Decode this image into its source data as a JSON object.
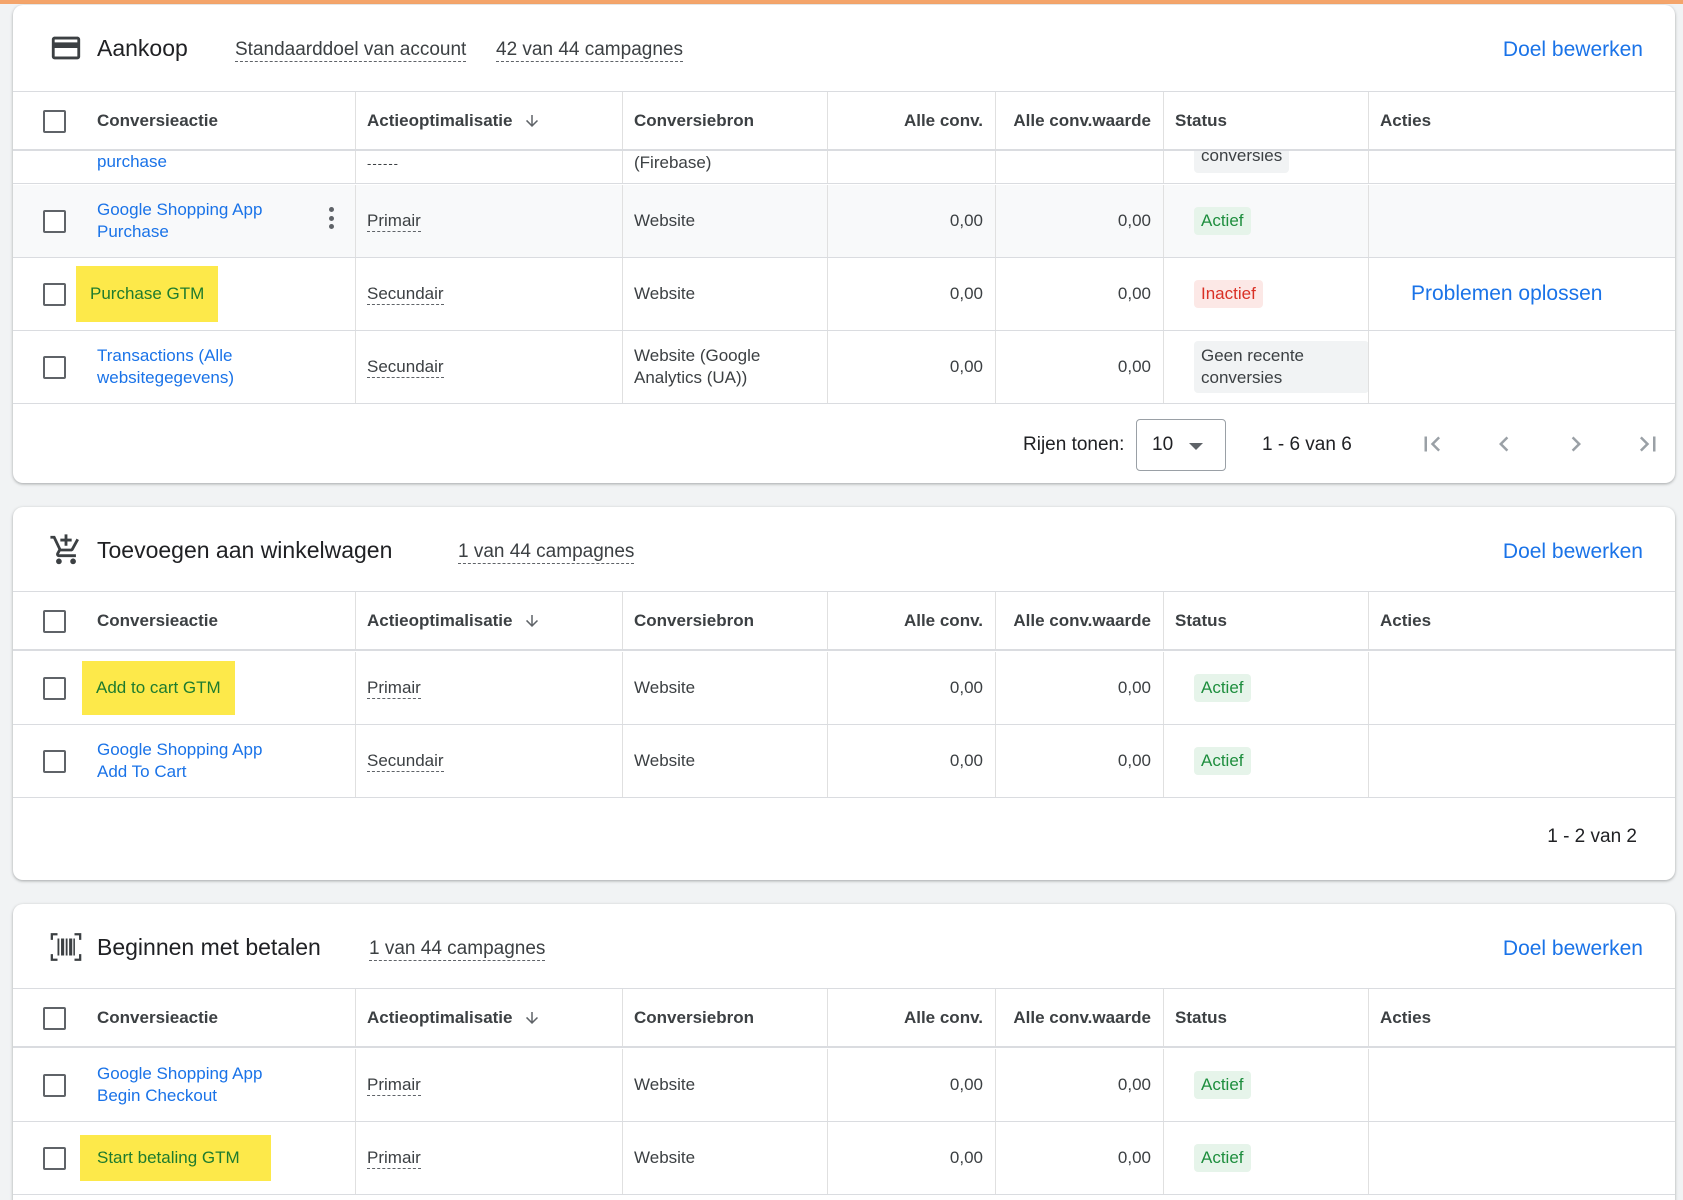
{
  "columns": {
    "name": "Conversieactie",
    "optimization": "Actieoptimalisatie",
    "source": "Conversiebron",
    "all_conv": "Alle conv.",
    "all_conv_value": "Alle conv.waarde",
    "status": "Status",
    "actions": "Acties"
  },
  "goals": [
    {
      "title": "Aankoop",
      "meta1": "Standaarddoel van account",
      "meta2": "42 van 44 campagnes",
      "edit_label": "Doel bewerken",
      "partial_row": {
        "name": "purchase",
        "optimization": "------",
        "source": "(Firebase)",
        "status": "conversies"
      },
      "rows": [
        {
          "name_line1": "Google Shopping App",
          "name_line2": "Purchase",
          "optimization": "Primair",
          "source": "Website",
          "conv": "0,00",
          "value": "0,00",
          "status": "Actief"
        },
        {
          "name_line1": "Purchase GTM",
          "optimization": "Secundair",
          "source": "Website",
          "conv": "0,00",
          "value": "0,00",
          "status": "Inactief",
          "action": "Problemen oplossen"
        },
        {
          "name_line1": "Transactions (Alle",
          "name_line2": "websitegegevens)",
          "optimization": "Secundair",
          "source_line1": "Website (Google",
          "source_line2": "Analytics (UA))",
          "conv": "0,00",
          "value": "0,00",
          "status_line1": "Geen recente",
          "status_line2": "conversies"
        }
      ],
      "footer": {
        "rows_label": "Rijen tonen:",
        "rows_value": "10",
        "range": "1 - 6 van 6"
      }
    },
    {
      "title": "Toevoegen aan winkelwagen",
      "meta1": "1 van 44 campagnes",
      "edit_label": "Doel bewerken",
      "rows": [
        {
          "name_line1": "Add to cart GTM",
          "optimization": "Primair",
          "source": "Website",
          "conv": "0,00",
          "value": "0,00",
          "status": "Actief"
        },
        {
          "name_line1": "Google Shopping App",
          "name_line2": "Add To Cart",
          "optimization": "Secundair",
          "source": "Website",
          "conv": "0,00",
          "value": "0,00",
          "status": "Actief"
        }
      ],
      "footer": {
        "range": "1 - 2 van 2"
      }
    },
    {
      "title": "Beginnen met betalen",
      "meta1": "1 van 44 campagnes",
      "edit_label": "Doel bewerken",
      "rows": [
        {
          "name_line1": "Google Shopping App",
          "name_line2": "Begin Checkout",
          "optimization": "Primair",
          "source": "Website",
          "conv": "0,00",
          "value": "0,00",
          "status": "Actief"
        },
        {
          "name_line1": "Start betaling GTM",
          "optimization": "Primair",
          "source": "Website",
          "conv": "0,00",
          "value": "0,00",
          "status": "Actief"
        }
      ]
    }
  ],
  "colors": {
    "link": "#1a73e8",
    "highlight": "#fde94a",
    "active": "#1e8e3e",
    "inactive": "#d93025"
  },
  "icons": [
    "credit-card-icon",
    "add-shopping-cart-icon",
    "barcode-scanner-icon",
    "arrow-downward-icon",
    "more-vert-icon",
    "first-page-icon",
    "chevron-left-icon",
    "chevron-right-icon",
    "last-page-icon"
  ]
}
